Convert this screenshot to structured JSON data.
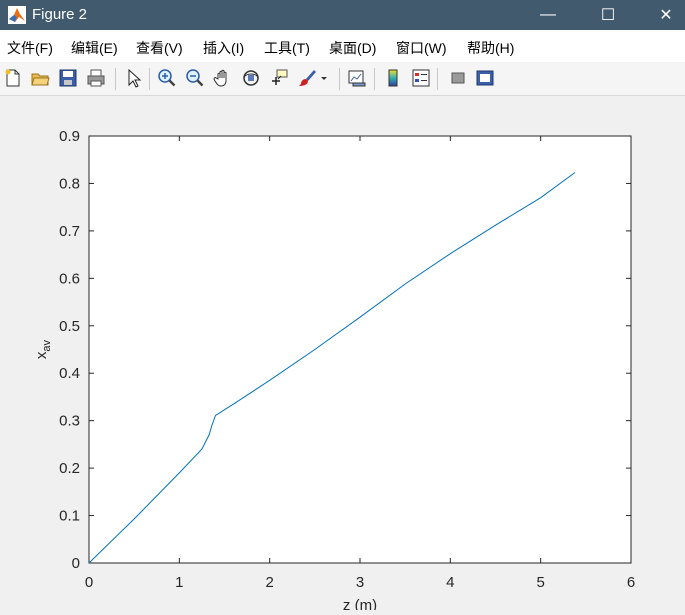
{
  "window": {
    "title": "Figure 2",
    "minimize_glyph": "—",
    "maximize_glyph": "☐",
    "close_glyph": "✕"
  },
  "menu": {
    "items": [
      "文件(F)",
      "编辑(E)",
      "查看(V)",
      "插入(I)",
      "工具(T)",
      "桌面(D)",
      "窗口(W)",
      "帮助(H)"
    ]
  },
  "toolbar": {
    "icons": [
      "new-figure-icon",
      "open-file-icon",
      "save-icon",
      "print-icon",
      "select-arrow-icon",
      "zoom-in-icon",
      "zoom-out-icon",
      "pan-hand-icon",
      "rotate-3d-icon",
      "data-cursor-icon",
      "brush-icon",
      "brush-dropdown-icon",
      "link-plot-icon",
      "insert-colorbar-icon",
      "insert-legend-icon",
      "hide-plot-tools-icon",
      "show-plot-tools-icon"
    ]
  },
  "colors": {
    "titlebar": "#415a6e",
    "line": "#0072bd",
    "figure_bg": "#f0f0f0",
    "axes_bg": "#ffffff"
  },
  "chart_data": {
    "type": "line",
    "xlabel": "z (m)",
    "ylabel_main": "x",
    "ylabel_sub": "av",
    "xlim": [
      0,
      6
    ],
    "ylim": [
      0,
      0.9
    ],
    "xticks": [
      "0",
      "1",
      "2",
      "3",
      "4",
      "5",
      "6"
    ],
    "yticks": [
      "0",
      "0.1",
      "0.2",
      "0.3",
      "0.4",
      "0.5",
      "0.6",
      "0.7",
      "0.8",
      "0.9"
    ],
    "grid": false,
    "series": [
      {
        "x": [
          0,
          0.5,
          1.0,
          1.25,
          1.33,
          1.36,
          1.4,
          1.6,
          2.0,
          2.5,
          3.0,
          3.5,
          4.0,
          4.5,
          5.0,
          5.38
        ],
        "y": [
          0,
          0.093,
          0.19,
          0.24,
          0.27,
          0.29,
          0.311,
          0.335,
          0.385,
          0.45,
          0.518,
          0.588,
          0.652,
          0.712,
          0.77,
          0.823
        ]
      }
    ]
  }
}
